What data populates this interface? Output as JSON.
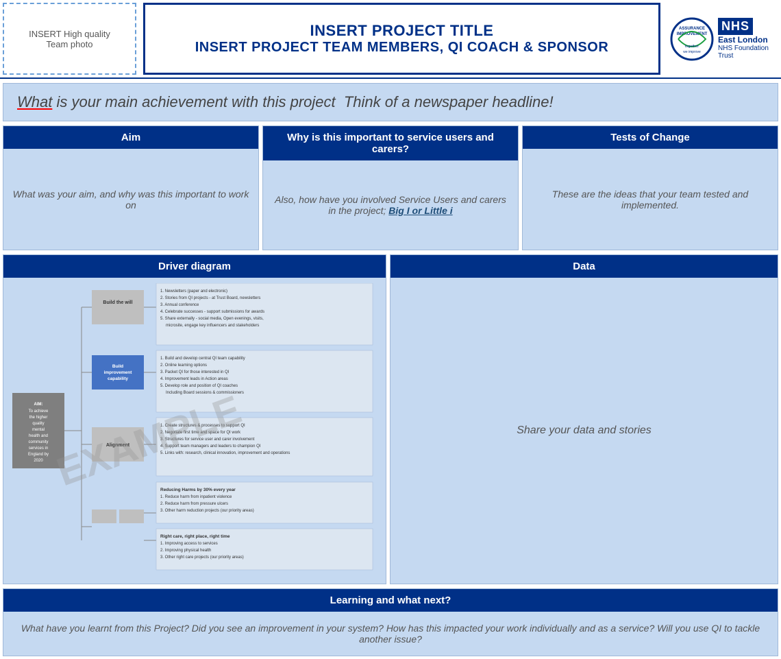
{
  "header": {
    "photo_placeholder": "INSERT High quality\nTeam photo",
    "title_line1": "INSERT PROJECT TITLE",
    "title_line2": "INSERT PROJECT TEAM MEMBERS, QI COACH & SPONSOR",
    "nhs_label": "NHS",
    "nhs_org": "East London",
    "nhs_trust": "NHS Foundation Trust",
    "nhs_circle_text": "ASSURANCE\nIMPROVEMENT"
  },
  "headline": {
    "text": "What is your main achievement with this project  Think of a newspaper headline!"
  },
  "aim": {
    "header": "Aim",
    "body": "What was your aim, and why was this important to work on"
  },
  "why_important": {
    "header": "Why is this important to service users and carers?",
    "body_part1": "Also, how have you involved Service Users and carers in the project;",
    "link_text": "Big I or Little i"
  },
  "tests_of_change": {
    "header": "Tests of Change",
    "body": "These are the ideas that your team tested and implemented."
  },
  "driver_diagram": {
    "header": "Driver diagram",
    "aim_label": "AIM:\nTo achieve\nthe higher\nquality\nmental\nhealth and\ncommunity\nservices in\nEngland by\n2020",
    "driver1": "Build the will",
    "driver2": "Build\nimprovement\ncapability",
    "driver3": "Alignment",
    "driver4": "",
    "text1": "1. Newsletters (paper and electronic)\n2. Stories from QI projects - at Trust Board, newsletters\n3. Annual conference\n4. Celebrate successes - support submissions for awards\n5. Share externally - social media, Open evenings, visits,\n    microsite, engage key influencers and stakeholders",
    "text2": "1. Build and develop central QI team capability\n2. Online learning options\n3. Packet QI for those interested in QI\n4. Improvement leads in Action areas\n5. Develop role and position of QI coaches\n   Including Board sessions & commissioners",
    "text3": "1. Create structures & processes to support QI\n2. Negotiate first time and space for QI work\n3. Structures for service user and carer involvement\n4. Support team managers and leaders to champion QI\n5. Links with: research, clinical innovation, improvement and operations",
    "text4": "Reducing Harms by 30% every year\n1. Reduce harm from inpatient violence\n2. Reduce harm from pressure ulcers\n3. Other harm reduction projects (our priority areas)",
    "text5": "Right care, right place, right time\n1. Improving access to services\n2. Improving physical health\n3. Other right care projects (our priority areas)",
    "watermark": "EXAMPLE"
  },
  "data": {
    "header": "Data",
    "body": "Share your data and stories"
  },
  "learning": {
    "header": "Learning and what next?",
    "body": "What have you learnt from this Project? Did you see an improvement in your system? How has this impacted your work individually and as a service? Will you use QI to tackle another issue?"
  }
}
